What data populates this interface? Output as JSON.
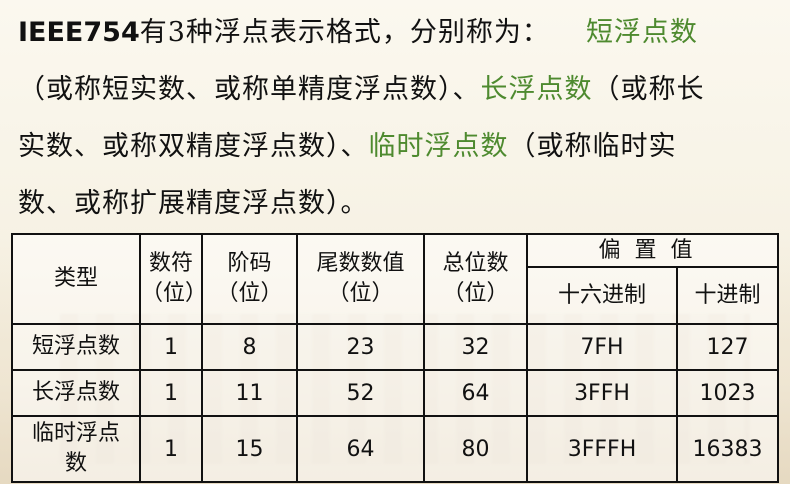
{
  "paragraph": {
    "l1_text": "有3种浮点表示格式，分别称为：",
    "l1_prefix": "IEEE754",
    "term_short": "短浮点数",
    "l2_text": "（或称短实数、或称单精度浮点数）、",
    "term_long": "长浮点数",
    "l2_tail": "（或称长",
    "l3_text": "实数、或称双精度浮点数）、",
    "term_temp": "临时浮点数",
    "l3_tail": "（或称临时实",
    "l4_text": "数、或称扩展精度浮点数）。"
  },
  "table": {
    "headers": {
      "type": "类型",
      "sign": [
        "数符",
        "（位）"
      ],
      "exp": [
        "阶码",
        "（位）"
      ],
      "mant": [
        "尾数数值",
        "（位）"
      ],
      "total": [
        "总位数",
        "（位）"
      ],
      "bias": "偏置值",
      "hex": "十六进制",
      "dec": "十进制"
    },
    "rows": [
      {
        "name": "短浮点数",
        "sign": "1",
        "exp": "8",
        "mant": "23",
        "total": "32",
        "hex": "7FH",
        "dec": "127"
      },
      {
        "name": "长浮点数",
        "sign": "1",
        "exp": "11",
        "mant": "52",
        "total": "64",
        "hex": "3FFH",
        "dec": "1023"
      },
      {
        "name": "临时浮点数",
        "sign": "1",
        "exp": "15",
        "mant": "64",
        "total": "80",
        "hex": "3FFFH",
        "dec": "16383"
      }
    ]
  },
  "colors": {
    "highlight": "#4e8a2f"
  }
}
